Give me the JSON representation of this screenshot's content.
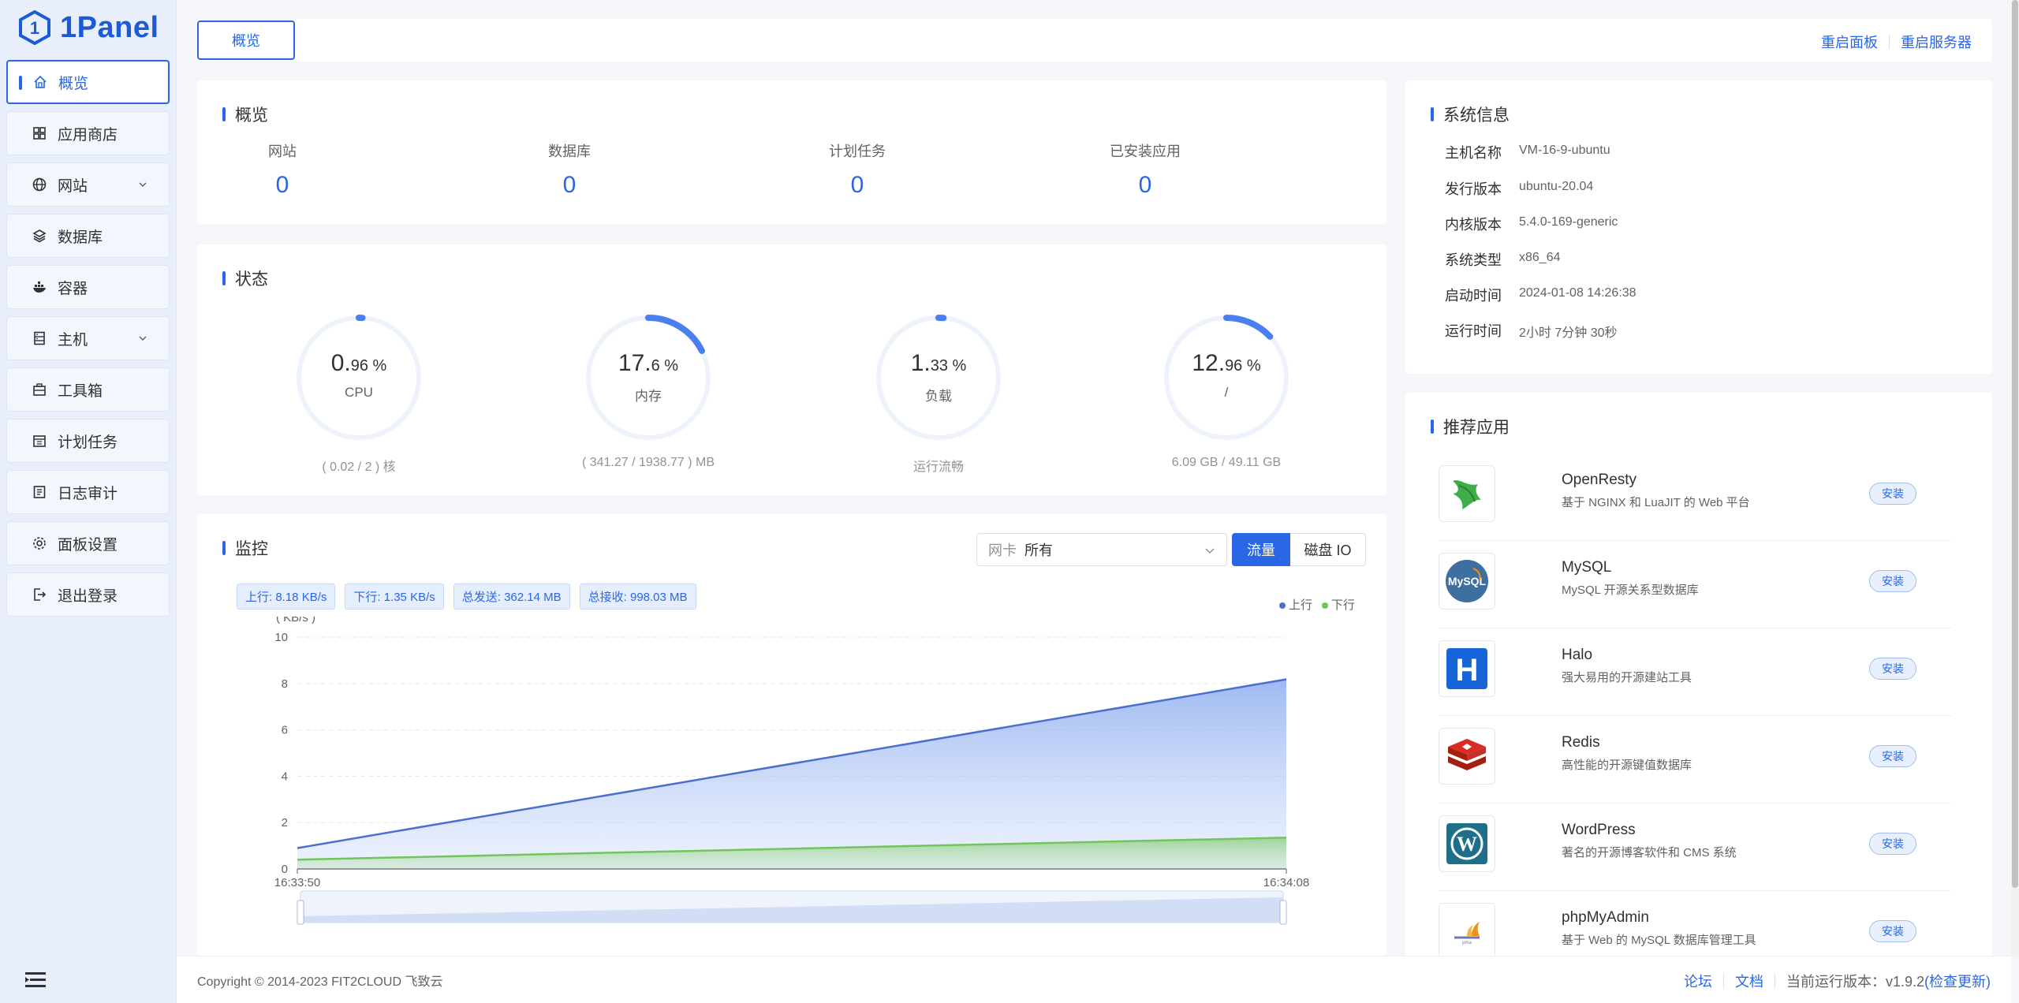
{
  "brand": {
    "name": "1Panel",
    "accent": "#2a66e6"
  },
  "sidebar": {
    "items": [
      {
        "label": "概览",
        "icon": "home-icon",
        "active": true
      },
      {
        "label": "应用商店",
        "icon": "grid-icon"
      },
      {
        "label": "网站",
        "icon": "globe-icon",
        "expandable": true
      },
      {
        "label": "数据库",
        "icon": "layers-icon"
      },
      {
        "label": "容器",
        "icon": "docker-icon"
      },
      {
        "label": "主机",
        "icon": "server-icon",
        "expandable": true
      },
      {
        "label": "工具箱",
        "icon": "toolbox-icon"
      },
      {
        "label": "计划任务",
        "icon": "calendar-icon"
      },
      {
        "label": "日志审计",
        "icon": "log-icon"
      },
      {
        "label": "面板设置",
        "icon": "gear-icon"
      },
      {
        "label": "退出登录",
        "icon": "logout-icon"
      }
    ]
  },
  "topbar": {
    "tab": "概览",
    "restart_panel": "重启面板",
    "restart_server": "重启服务器"
  },
  "overview": {
    "title": "概览",
    "stats": [
      {
        "label": "网站",
        "value": "0"
      },
      {
        "label": "数据库",
        "value": "0"
      },
      {
        "label": "计划任务",
        "value": "0"
      },
      {
        "label": "已安装应用",
        "value": "0"
      }
    ]
  },
  "status": {
    "title": "状态",
    "gauges": [
      {
        "int": "0.",
        "dec": "96 %",
        "label": "CPU",
        "sub": "( 0.02 / 2 ) 核",
        "percent": 0.96
      },
      {
        "int": "17.",
        "dec": "6 %",
        "label": "内存",
        "sub": "( 341.27 / 1938.77 ) MB",
        "percent": 17.6
      },
      {
        "int": "1.",
        "dec": "33 %",
        "label": "负载",
        "sub": "运行流畅",
        "percent": 1.33
      },
      {
        "int": "12.",
        "dec": "96 %",
        "label": "/",
        "sub": "6.09 GB / 49.11 GB",
        "percent": 12.96
      }
    ]
  },
  "monitor": {
    "title": "监控",
    "select_label": "网卡",
    "select_value": "所有",
    "seg_on": "流量",
    "seg_off": "磁盘 IO",
    "chips": [
      "上行: 8.18 KB/s",
      "下行: 1.35 KB/s",
      "总发送: 362.14 MB",
      "总接收: 998.03 MB"
    ],
    "legend_up": "上行",
    "legend_down": "下行",
    "unit": "( KB/s )",
    "colors": {
      "up": "#4a6fd0",
      "down": "#73c45a"
    }
  },
  "chart_data": {
    "type": "area",
    "x": [
      "16:33:50",
      "16:34:08"
    ],
    "series": [
      {
        "name": "上行",
        "values": [
          0.9,
          8.18
        ]
      },
      {
        "name": "下行",
        "values": [
          0.4,
          1.35
        ]
      }
    ],
    "ylabel": "( KB/s )",
    "ylim": [
      0,
      10
    ],
    "yticks": [
      0,
      2,
      4,
      6,
      8,
      10
    ],
    "legend": "top-right",
    "grid": true
  },
  "sysinfo": {
    "title": "系统信息",
    "rows": [
      {
        "k": "主机名称",
        "v": "VM-16-9-ubuntu"
      },
      {
        "k": "发行版本",
        "v": "ubuntu-20.04"
      },
      {
        "k": "内核版本",
        "v": "5.4.0-169-generic"
      },
      {
        "k": "系统类型",
        "v": "x86_64"
      },
      {
        "k": "启动时间",
        "v": "2024-01-08 14:26:38"
      },
      {
        "k": "运行时间",
        "v": "2小时 7分钟 30秒"
      }
    ]
  },
  "apps": {
    "title": "推荐应用",
    "install_label": "安装",
    "items": [
      {
        "name": "OpenResty",
        "desc": "基于 NGINX 和 LuaJIT 的 Web 平台",
        "icon": "openresty-icon"
      },
      {
        "name": "MySQL",
        "desc": "MySQL 开源关系型数据库",
        "icon": "mysql-icon"
      },
      {
        "name": "Halo",
        "desc": "强大易用的开源建站工具",
        "icon": "halo-icon"
      },
      {
        "name": "Redis",
        "desc": "高性能的开源键值数据库",
        "icon": "redis-icon"
      },
      {
        "name": "WordPress",
        "desc": "著名的开源博客软件和 CMS 系统",
        "icon": "wordpress-icon"
      },
      {
        "name": "phpMyAdmin",
        "desc": "基于 Web 的 MySQL 数据库管理工具",
        "icon": "phpmyadmin-icon"
      }
    ]
  },
  "footer": {
    "copyright": "Copyright © 2014-2023 FIT2CLOUD 飞致云",
    "forum": "论坛",
    "docs": "文档",
    "version_label": "当前运行版本：v1.9.2",
    "check_update": "(检查更新)"
  }
}
